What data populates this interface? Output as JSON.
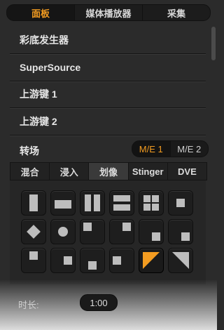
{
  "top_tabs": [
    "面板",
    "媒体播放器",
    "采集"
  ],
  "sections": [
    "彩底发生器",
    "SuperSource",
    "上游键 1",
    "上游键 2"
  ],
  "transition": {
    "title": "转场",
    "me_options": [
      "M/E 1",
      "M/E 2"
    ],
    "tabs": [
      "混合",
      "浸入",
      "划像",
      "Stinger",
      "DVE"
    ],
    "active_tab": "划像"
  },
  "duration": {
    "label": "时长:",
    "value": "1:00"
  },
  "colors": {
    "accent": "#f39c21"
  }
}
